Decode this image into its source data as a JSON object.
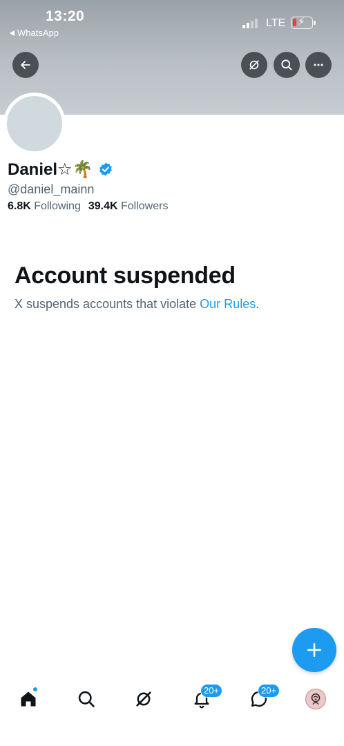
{
  "status_bar": {
    "time": "13:20",
    "back_app": "WhatsApp",
    "network": "LTE",
    "battery_level": 0.15
  },
  "header": {
    "back_icon": "arrow-left-icon",
    "grok_icon": "grok-icon",
    "search_icon": "search-icon",
    "more_icon": "more-horizontal-icon"
  },
  "profile": {
    "name": "Daniel☆🌴",
    "verified": true,
    "handle": "@daniel_mainn",
    "following_count": "6.8K",
    "following_label": "Following",
    "followers_count": "39.4K",
    "followers_label": "Followers"
  },
  "suspension": {
    "title": "Account suspended",
    "text": "X suspends accounts that violate ",
    "link": "Our Rules",
    "suffix": "."
  },
  "bottom_nav": {
    "items": [
      {
        "name": "home",
        "icon": "home-icon",
        "has_dot": true
      },
      {
        "name": "search",
        "icon": "search-icon"
      },
      {
        "name": "grok",
        "icon": "grok-icon"
      },
      {
        "name": "notifications",
        "icon": "bell-icon",
        "badge": "20+"
      },
      {
        "name": "messages",
        "icon": "messages-icon",
        "badge": "20+"
      },
      {
        "name": "profile",
        "icon": "avatar-icon"
      }
    ]
  },
  "colors": {
    "accent": "#1d9bf0",
    "text": "#0f1419",
    "secondary_text": "#536471",
    "banner": "#b9c0c5"
  }
}
